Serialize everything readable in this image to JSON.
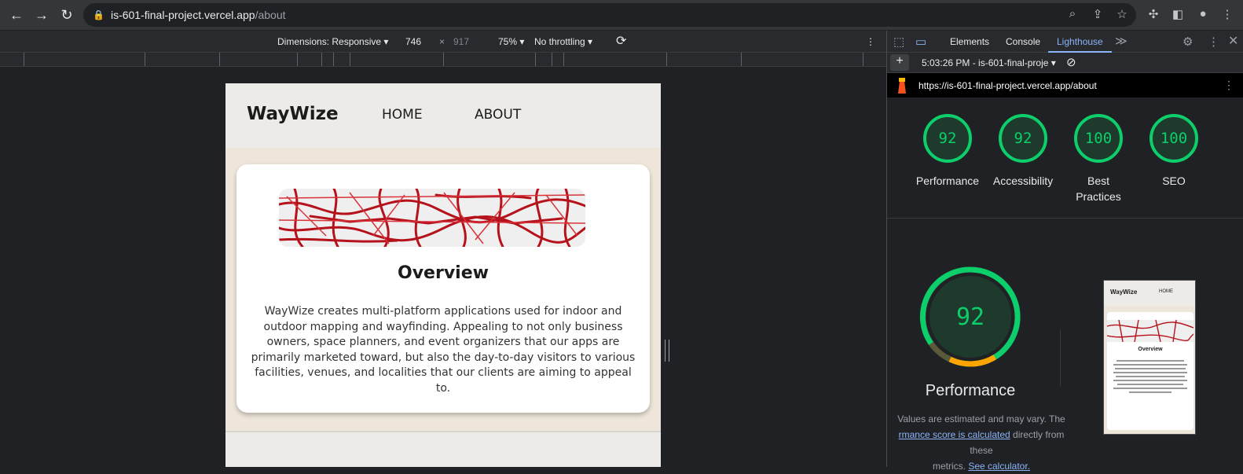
{
  "browser": {
    "url_host": "is-601-final-project.vercel.app",
    "url_path": "/about"
  },
  "device_toolbar": {
    "dimensions_label": "Dimensions: Responsive",
    "width": "746",
    "times": "×",
    "height": "917",
    "zoom": "75%",
    "throttling": "No throttling"
  },
  "site": {
    "brand": "WayWize",
    "nav": [
      "HOME",
      "ABOUT"
    ],
    "card": {
      "title": "Overview",
      "description": "WayWize creates multi-platform applications used for indoor and outdoor mapping and wayfinding. Appealing to not only business owners, space planners, and event organizers that our apps are primarily marketed toward, but also the day-to-day visitors to various facilities, venues, and localities that our clients are aiming to appeal to."
    }
  },
  "devtools": {
    "tabs": [
      "Elements",
      "Console",
      "Lighthouse"
    ],
    "active_tab": "Lighthouse",
    "report_selector": "5:03:26 PM - is-601-final-proje",
    "report_url": "https://is-601-final-project.vercel.app/about",
    "scores": [
      {
        "value": "92",
        "label": "Performance"
      },
      {
        "value": "92",
        "label": "Accessibility"
      },
      {
        "value": "100",
        "label": "Best Practices"
      },
      {
        "value": "100",
        "label": "SEO"
      }
    ],
    "score_color": "#0cce6b",
    "performance": {
      "score": "92",
      "title": "Performance",
      "note_1": "Values are estimated and may vary. The",
      "note_link_1": "rmance score is calculated",
      "note_2": " directly from these",
      "note_3": "metrics. ",
      "note_link_2": "See calculator."
    },
    "thumbnail": {
      "brand": "WayWize",
      "nav": "HOME",
      "title": "Overview"
    }
  }
}
